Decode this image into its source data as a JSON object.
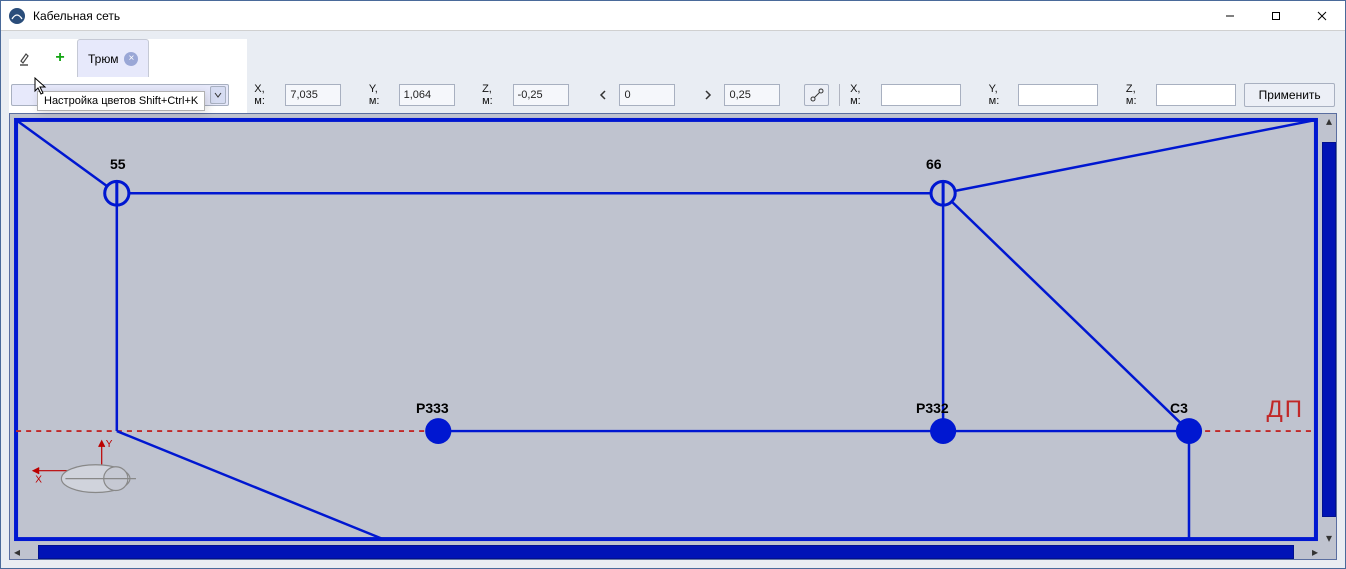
{
  "title": "Кабельная сеть",
  "tabs": {
    "name": "Трюм"
  },
  "tooltip": "Настройка цветов Shift+Ctrl+K",
  "toolbar": {
    "x_label": "X, м:",
    "y_label": "Y, м:",
    "z_label": "Z, м:",
    "x_value": "7,035",
    "y_value": "1,064",
    "z_value": "-0,25",
    "range_lo": "0",
    "range_hi": "0,25",
    "x2_label": "X, м:",
    "y2_label": "Y, м:",
    "z2_label": "Z, м:",
    "apply": "Применить"
  },
  "canvas": {
    "dp": "ДП",
    "nodes": {
      "n55": "55",
      "n66": "66",
      "p333": "Р333",
      "p332": "Р332",
      "c3": "С3"
    }
  }
}
